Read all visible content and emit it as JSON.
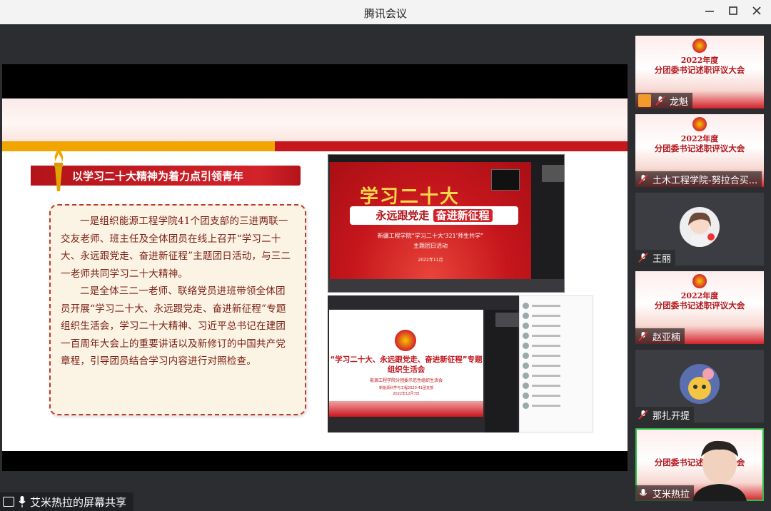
{
  "window": {
    "title": "腾讯会议"
  },
  "slide": {
    "heading": "以学习二十大精神为着力点引领青年",
    "paragraph1": "一是组织能源工程学院41个团支部的三进两联一交友老师、班主任及全体团员在线上召开“学习二十大、永远跟党走、奋进新征程”主题团日活动，与三二一老师共同学习二十大精神。",
    "paragraph2": "二是全体三二一老师、联络党员进班带领全体团员开展“学习二十大、永远跟党走、奋进新征程”专题组织生活会，学习二十大精神、习近平总书记在建团一百周年大会上的重要讲话以及新修订的中国共产党章程，引导团员结合学习内容进行对照检查。",
    "shot1": {
      "big_title": "学习二十大",
      "banner_left": "永远跟党走",
      "banner_right": "奋进新征程",
      "sub1": "新疆工程学院“学习二十大‘321’师生共学”",
      "sub2": "主题团日活动",
      "date": "2022年11月"
    },
    "shot2": {
      "title_line1": "“学习二十大、永远跟党走、奋进新征程”专题",
      "title_line2": "组织生活会",
      "line3": "能源工程学院分团委示范性组织生活会",
      "line4": "新能源科学与工程2020-41团支部",
      "line5": "2022年12月7日"
    }
  },
  "share_label": "艾米热拉的屏幕共享",
  "participants": [
    {
      "name": "龙魁",
      "type": "slide",
      "t1": "2022年度",
      "t2": "分团委书记述职评议大会"
    },
    {
      "name": "土木工程学院-努拉合买...",
      "type": "slide",
      "t1": "2022年度",
      "t2": "分团委书记述职评议大会"
    },
    {
      "name": "王丽",
      "type": "avatar"
    },
    {
      "name": "赵亚楠",
      "type": "slide",
      "t1": "2022年度",
      "t2": "分团委书记述职评议大会"
    },
    {
      "name": "那扎开提",
      "type": "avatar"
    },
    {
      "name": "艾米热拉",
      "type": "camera",
      "t2": "分团委书记述职评议大会"
    }
  ],
  "colors": {
    "accent_red": "#c8161d",
    "accent_yellow": "#f1a500",
    "speaking_green": "#2fbf4a"
  }
}
